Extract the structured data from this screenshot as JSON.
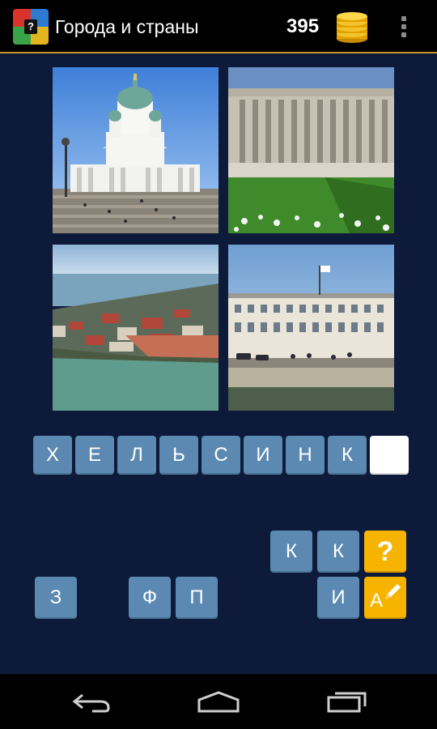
{
  "header": {
    "title": "Города и страны",
    "coins": "395",
    "app_icon_letter": "?"
  },
  "photos": [
    {
      "name": "photo-cathedral",
      "subject": "cathedral"
    },
    {
      "name": "photo-parliament",
      "subject": "parliament"
    },
    {
      "name": "photo-aerial-city",
      "subject": "aerial-city"
    },
    {
      "name": "photo-palace-waterfront",
      "subject": "palace-waterfront"
    }
  ],
  "answer_slots": [
    "Х",
    "Е",
    "Л",
    "Ь",
    "С",
    "И",
    "Н",
    "К",
    ""
  ],
  "letter_bank": {
    "row1": [
      "К",
      "К"
    ],
    "row2": [
      "З",
      "Ф",
      "П",
      "И"
    ]
  },
  "hint_buttons": {
    "hint": "?",
    "reveal": "A"
  },
  "colors": {
    "background": "#0e1a3a",
    "tile": "#5b89b1",
    "hint": "#f6b400",
    "accent_line": "#c7962a"
  },
  "icons": {
    "coins": "coin-stack-icon",
    "menu": "overflow-menu-icon",
    "back": "back-icon",
    "home": "home-icon",
    "recents": "recents-icon",
    "reveal": "pencil-icon"
  }
}
